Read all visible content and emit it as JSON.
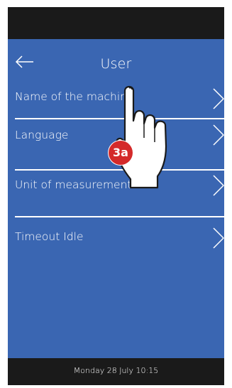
{
  "header": {
    "title": "User",
    "back_icon": "arrow-left-icon"
  },
  "menu": {
    "items": [
      {
        "label": "Name of the machine",
        "icon": "chevron-right-icon"
      },
      {
        "label": "Language",
        "icon": "chevron-right-icon"
      },
      {
        "label": "Unit of measurement",
        "icon": "chevron-right-icon"
      },
      {
        "label": "Timeout Idle",
        "icon": "chevron-right-icon"
      }
    ]
  },
  "footer": {
    "datetime": "Monday 28 July 10:15"
  },
  "annotation": {
    "step_label": "3a",
    "pointer_icon": "pointing-hand-icon"
  },
  "colors": {
    "screen_bg": "#3a66b2",
    "bezel": "#1a1a1a",
    "text": "#ffffff",
    "badge": "#d42a2a"
  }
}
